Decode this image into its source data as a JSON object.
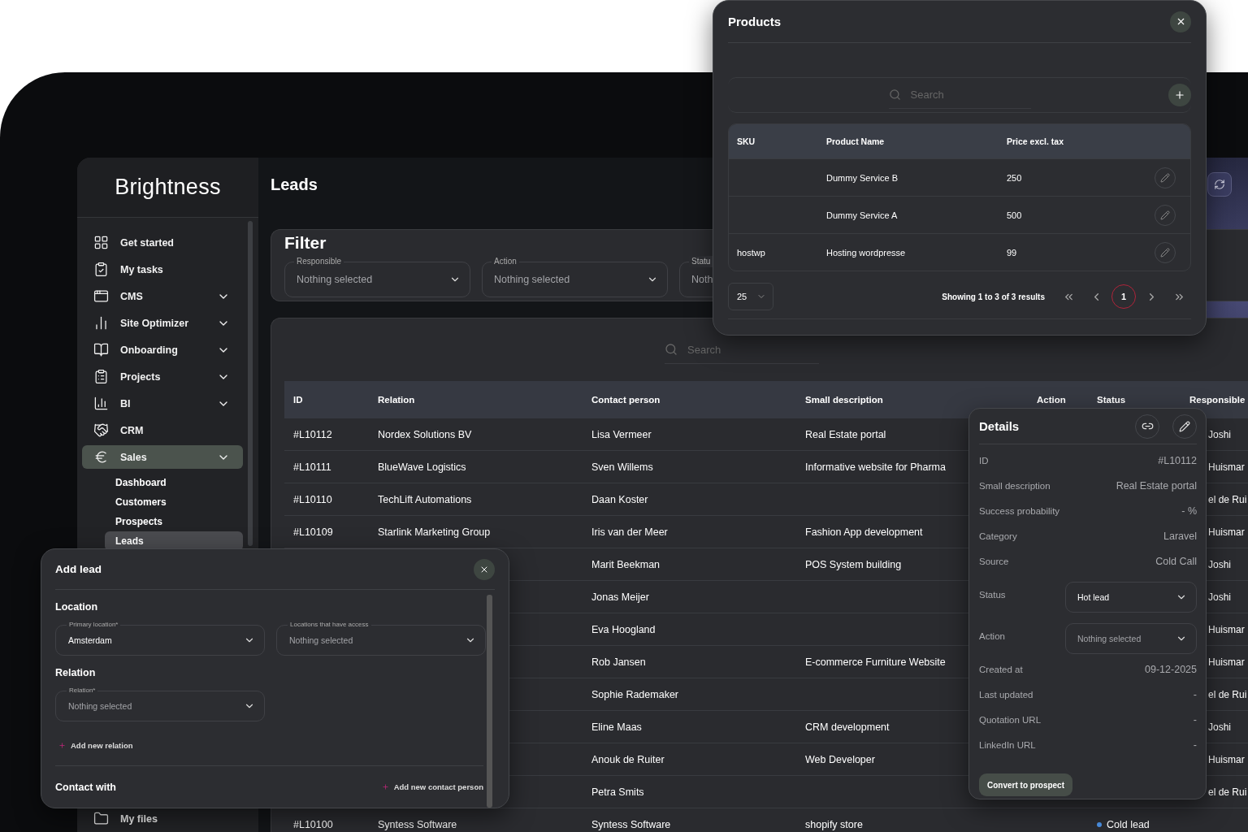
{
  "sidebar": {
    "logo": "Brightness",
    "items": [
      {
        "label": "Get started",
        "expandable": false,
        "selected": false
      },
      {
        "label": "My tasks",
        "expandable": false,
        "selected": false
      },
      {
        "label": "CMS",
        "expandable": true,
        "selected": false
      },
      {
        "label": "Site Optimizer",
        "expandable": true,
        "selected": false
      },
      {
        "label": "Onboarding",
        "expandable": true,
        "selected": false
      },
      {
        "label": "Projects",
        "expandable": true,
        "selected": false
      },
      {
        "label": "BI",
        "expandable": true,
        "selected": false
      },
      {
        "label": "CRM",
        "expandable": false,
        "selected": false
      },
      {
        "label": "Sales",
        "expandable": true,
        "selected": true,
        "children": [
          {
            "label": "Dashboard",
            "selected": false
          },
          {
            "label": "Customers",
            "selected": false
          },
          {
            "label": "Prospects",
            "selected": false
          },
          {
            "label": "Leads",
            "selected": true
          }
        ]
      }
    ],
    "bottom_items": [
      {
        "label": "My files",
        "selected": false
      }
    ]
  },
  "page": {
    "title": "Leads"
  },
  "filter": {
    "title": "Filter",
    "fields": [
      {
        "label": "Responsible",
        "placeholder": "Nothing selected"
      },
      {
        "label": "Action",
        "placeholder": "Nothing selected"
      },
      {
        "label": "Statu",
        "placeholder": "Noth"
      }
    ]
  },
  "leads_table": {
    "search": {
      "placeholder": "Search"
    },
    "columns": [
      "ID",
      "Relation",
      "Contact person",
      "Small description",
      "Action",
      "Status",
      "Responsible"
    ],
    "rows": [
      {
        "id": "#L10112",
        "relation": "Nordex Solutions BV",
        "contact": "Lisa Vermeer",
        "description": "Real Estate portal",
        "responsible": "Joshi"
      },
      {
        "id": "#L10111",
        "relation": "BlueWave Logistics",
        "contact": "Sven Willems",
        "description": "Informative website for Pharma",
        "responsible": "Huismar"
      },
      {
        "id": "#L10110",
        "relation": "TechLift Automations",
        "contact": "Daan Koster",
        "responsible": "el de Rui"
      },
      {
        "id": "#L10109",
        "relation": "Starlink Marketing Group",
        "contact": "Iris van der Meer",
        "description": "Fashion App development",
        "responsible": "Huismar"
      },
      {
        "contact": "Marit Beekman",
        "description": "POS System building",
        "responsible": "Joshi"
      },
      {
        "contact": "Jonas Meijer",
        "responsible": "Joshi"
      },
      {
        "contact": "Eva Hoogland",
        "responsible": "Huismar"
      },
      {
        "contact": "Rob Jansen",
        "description": "E-commerce Furniture Website",
        "responsible": "Huismar"
      },
      {
        "contact": "Sophie Rademaker",
        "responsible": "el de Rui"
      },
      {
        "contact": "Eline Maas",
        "description": "CRM development",
        "responsible": "Joshi"
      },
      {
        "contact": "Anouk de Ruiter",
        "description": "Web Developer",
        "responsible": "Huismar"
      },
      {
        "contact": "Petra Smits",
        "responsible": "el de Rui"
      },
      {
        "id": "#L10100",
        "relation": "Syntess Software",
        "contact": "Syntess Software",
        "description": "shopify store",
        "status": {
          "label": "Cold lead",
          "color": "#4a8fe0"
        }
      }
    ]
  },
  "products": {
    "title": "Products",
    "search": {
      "placeholder": "Search"
    },
    "columns": [
      "SKU",
      "Product Name",
      "Price excl. tax"
    ],
    "rows": [
      {
        "name": "Dummy Service B",
        "price": "250"
      },
      {
        "name": "Dummy Service A",
        "price": "500"
      },
      {
        "sku": "hostwp",
        "name": "Hosting wordpresse",
        "price": "99"
      }
    ],
    "page_size": "25",
    "summary": "Showing 1 to 3 of 3 results",
    "pages": [
      {
        "label": "1",
        "selected": true
      }
    ]
  },
  "details": {
    "title": "Details",
    "fields": [
      {
        "kind": "text",
        "label": "ID",
        "value": "#L10112"
      },
      {
        "kind": "text",
        "label": "Small description",
        "value": "Real Estate portal"
      },
      {
        "kind": "text",
        "label": "Success probability",
        "value": "- %"
      },
      {
        "kind": "text",
        "label": "Category",
        "value": "Laravel"
      },
      {
        "kind": "text",
        "label": "Source",
        "value": "Cold Call"
      },
      {
        "kind": "select",
        "label": "Status",
        "value": "Hot lead"
      },
      {
        "kind": "select",
        "label": "Action",
        "placeholder": "Nothing selected"
      },
      {
        "kind": "text",
        "label": "Created at",
        "value": "09-12-2025"
      },
      {
        "kind": "text",
        "label": "Last updated",
        "value": "-"
      },
      {
        "kind": "text",
        "label": "Quotation URL",
        "value": "-"
      },
      {
        "kind": "text",
        "label": "LinkedIn URL",
        "value": "-"
      }
    ],
    "button": "Convert to prospect"
  },
  "add_lead": {
    "title": "Add lead",
    "sections": [
      {
        "title": "Location",
        "fields": [
          {
            "label": "Primary location*",
            "value": "Amsterdam"
          },
          {
            "label": "Locations that have access",
            "placeholder": "Nothing selected"
          }
        ]
      },
      {
        "title": "Relation",
        "fields": [
          {
            "label": "Relation*",
            "placeholder": "Nothing selected"
          }
        ],
        "link": "Add new relation"
      }
    ],
    "contact": {
      "title": "Contact with",
      "link": "Add new contact person"
    }
  }
}
